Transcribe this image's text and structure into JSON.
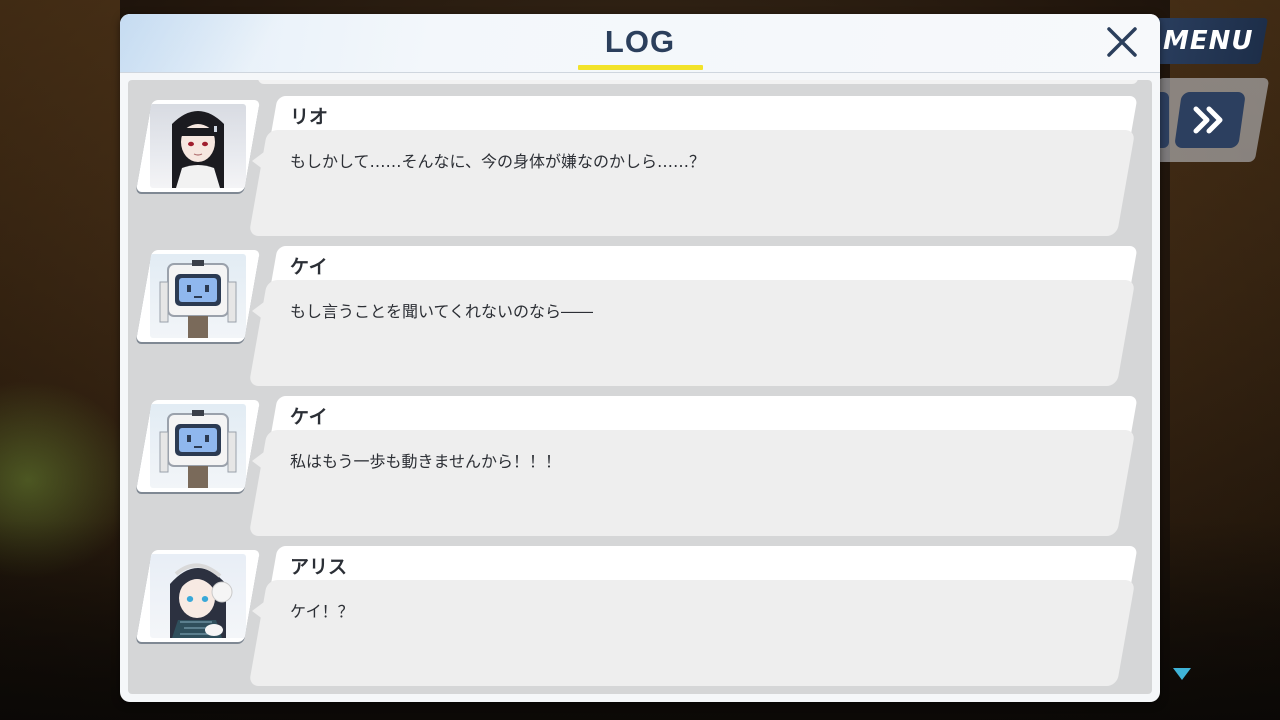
{
  "log": {
    "title": "LOG",
    "entries": [
      {
        "speaker": "リオ",
        "message": "もしかして……そんなに、今の身体が嫌なのかしら……？",
        "portrait": "rio-portrait"
      },
      {
        "speaker": "ケイ",
        "message": "もし言うことを聞いてくれないのなら――",
        "portrait": "kei-portrait"
      },
      {
        "speaker": "ケイ",
        "message": "私はもう一歩も動きませんから！！！",
        "portrait": "kei-portrait"
      },
      {
        "speaker": "アリス",
        "message": "ケイ！？",
        "portrait": "aris-portrait"
      }
    ]
  },
  "hud": {
    "menu_label": "MENU"
  },
  "colors": {
    "title_text": "#2b3f5c",
    "title_underline": "#f2e32a",
    "button_navy": "#2c3f5f"
  }
}
